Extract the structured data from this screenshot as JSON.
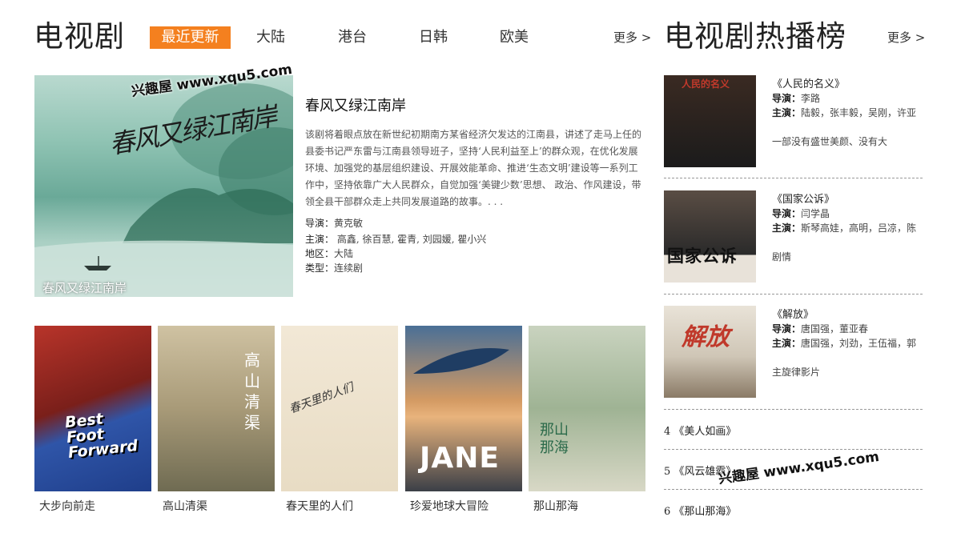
{
  "header": {
    "title": "电视剧",
    "tabs": [
      "最近更新",
      "大陆",
      "港台",
      "日韩",
      "欧美"
    ],
    "more": "更多 >"
  },
  "feature": {
    "poster_caption": "春风又绿江南岸",
    "poster_art_text": "春风又绿江南岸",
    "title": "春风又绿江南岸",
    "description": "该剧将着眼点放在新世纪初期南方某省经济欠发达的江南县，讲述了走马上任的县委书记严东雷与江南县领导班子，坚持‘人民利益至上’的群众观，在优化发展环境、加强党的基层组织建设、开展效能革命、推进‘生态文明’建设等一系列工作中，坚持依靠广大人民群众，自觉加强‘美键少数’思想、 政治、作风建设，带领全县干部群众走上共同发展道路的故事。. . .",
    "director_label": "导演：",
    "director": "黄克敏",
    "cast_label": "主演：",
    "cast": "高鑫, 徐百慧, 霍青, 刘园媛, 瞿小兴",
    "region_label": "地区：",
    "region": "大陆",
    "genre_label": "类型：",
    "genre": "连续剧"
  },
  "thumbnails": [
    {
      "title": "大步向前走",
      "art": "Best Foot Forward"
    },
    {
      "title": "高山清渠",
      "art": "高山清渠"
    },
    {
      "title": "春天里的人们",
      "art": "春天里的人们"
    },
    {
      "title": "珍爱地球大冒险",
      "art": "JANE"
    },
    {
      "title": "那山那海",
      "art": "那山那海"
    }
  ],
  "ranking": {
    "title": "电视剧热播榜",
    "more": "更多 >",
    "top": [
      {
        "title": "《人民的名义》",
        "director_label": "导演：",
        "director": "李路",
        "cast_label": "主演：",
        "cast": "陆毅，张丰毅，吴刚，许亚",
        "note": "一部没有盛世美颜、没有大",
        "poster_text": "人民的名义"
      },
      {
        "title": "《国家公诉》",
        "director_label": "导演：",
        "director": "闫学晶",
        "cast_label": "主演：",
        "cast": "斯琴高娃，高明，吕凉，陈",
        "note": "剧情",
        "poster_text": "国家公诉"
      },
      {
        "title": "《解放》",
        "director_label": "导演：",
        "director": "唐国强，董亚春",
        "cast_label": "主演：",
        "cast": "唐国强，刘劲，王伍福，郭",
        "note": "主旋律影片",
        "poster_text": "解放"
      }
    ],
    "rest": [
      "4 《美人如画》",
      "5 《风云雄霸》",
      "6 《那山那海》"
    ]
  },
  "watermarks": [
    "兴趣屋 www.xqu5.com",
    "兴趣屋 www.xqu5.com"
  ]
}
